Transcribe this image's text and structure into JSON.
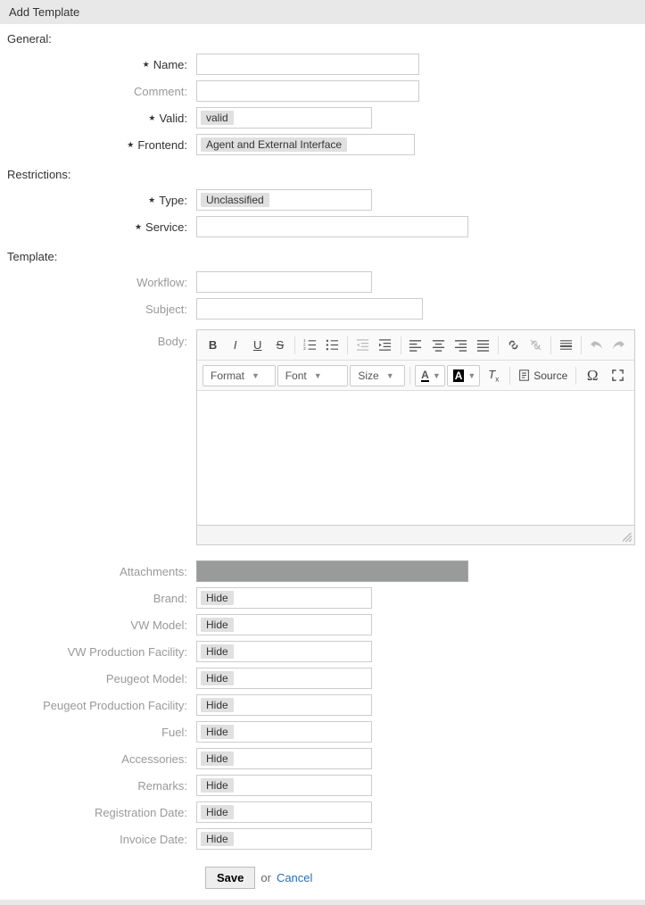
{
  "header": {
    "title": "Add Template"
  },
  "sections": {
    "general": "General:",
    "restrictions": "Restrictions:",
    "template": "Template:"
  },
  "general": {
    "name_label": "Name:",
    "comment_label": "Comment:",
    "valid_label": "Valid:",
    "valid_value": "valid",
    "frontend_label": "Frontend:",
    "frontend_value": "Agent and External Interface"
  },
  "restrictions": {
    "type_label": "Type:",
    "type_value": "Unclassified",
    "service_label": "Service:"
  },
  "template": {
    "workflow_label": "Workflow:",
    "subject_label": "Subject:",
    "body_label": "Body:"
  },
  "editor": {
    "format": "Format",
    "font": "Font",
    "size": "Size",
    "source": "Source"
  },
  "fields": {
    "attachments_label": "Attachments:",
    "brand_label": "Brand:",
    "vw_model_label": "VW Model:",
    "vw_prod_label": "VW Production Facility:",
    "peugeot_model_label": "Peugeot Model:",
    "peugeot_prod_label": "Peugeot Production Facility:",
    "fuel_label": "Fuel:",
    "accessories_label": "Accessories:",
    "remarks_label": "Remarks:",
    "reg_date_label": "Registration Date:",
    "invoice_date_label": "Invoice Date:",
    "hide": "Hide"
  },
  "actions": {
    "save": "Save",
    "or": "or",
    "cancel": "Cancel"
  }
}
